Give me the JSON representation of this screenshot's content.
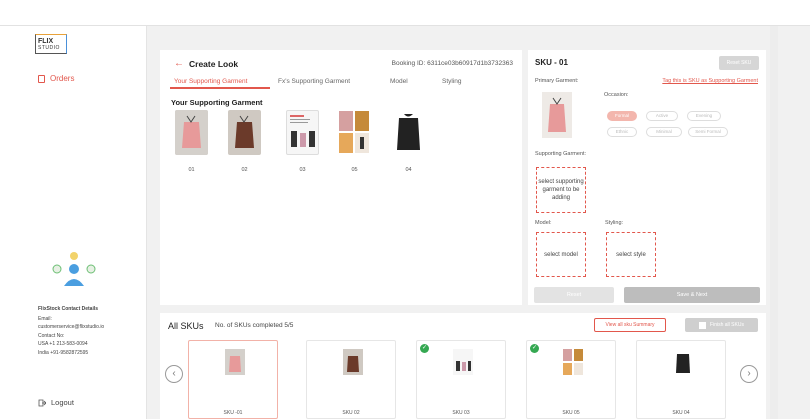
{
  "brand": {
    "name": "FLIX",
    "sub": "STUDIO",
    "accent": "#e2574c"
  },
  "sidebar": {
    "orders_label": "Orders",
    "contact": {
      "title": "FlixStock Contact Details",
      "email_label": "Email:",
      "email": "customerservice@flixstudio.io",
      "contact_label": "Contact No:",
      "usa": "USA +1 213-583-0094",
      "india": "India +91-9582872595"
    },
    "logout_label": "Logout"
  },
  "create_look": {
    "title": "Create Look",
    "booking": "Booking ID: 6311ce03b60917d1b3732363",
    "tabs": [
      "Your Supporting Garment",
      "Fx's Supporting Garment",
      "Model",
      "Styling"
    ],
    "active_tab": 0,
    "section_title": "Your Supporting Garment",
    "items": [
      {
        "label": "01",
        "icon": "pink-top"
      },
      {
        "label": "02",
        "icon": "brown-top"
      },
      {
        "label": "03",
        "icon": "spec-sheet"
      },
      {
        "label": "05",
        "icon": "collage"
      },
      {
        "label": "04",
        "icon": "black-sweater"
      }
    ]
  },
  "sku_panel": {
    "title": "SKU - 01",
    "reset_label": "Reset SKU",
    "primary_label": "Primary Garment:",
    "tag_link": "Tag this is SKU as Supporting Garment",
    "occasion_label": "Occasion:",
    "occasions": [
      "Formal",
      "Active",
      "Evening",
      "Ethnic",
      "Minimal",
      "Semi Formal"
    ],
    "active_occasion": 0,
    "supporting_label": "Supporting Garment:",
    "supporting_placeholder": "select supporting garment to be adding",
    "model_label": "Model:",
    "model_placeholder": "select model",
    "styling_label": "Styling:",
    "styling_placeholder": "select style",
    "reset_button": "Reset",
    "save_button": "Save & Next"
  },
  "all_skus": {
    "title": "All SKUs",
    "count_text": "No. of SKUs completed  5/5",
    "view_all_label": "View all sku Summary",
    "finish_label": "Finish all SKUs",
    "items": [
      {
        "label": "SKU -01",
        "checked": false
      },
      {
        "label": "SKU 02",
        "checked": false
      },
      {
        "label": "SKU 03",
        "checked": true
      },
      {
        "label": "SKU 05",
        "checked": true
      },
      {
        "label": "SKU 04",
        "checked": false
      }
    ],
    "prev_icon": "chevron-left-icon",
    "next_icon": "chevron-right-icon"
  }
}
